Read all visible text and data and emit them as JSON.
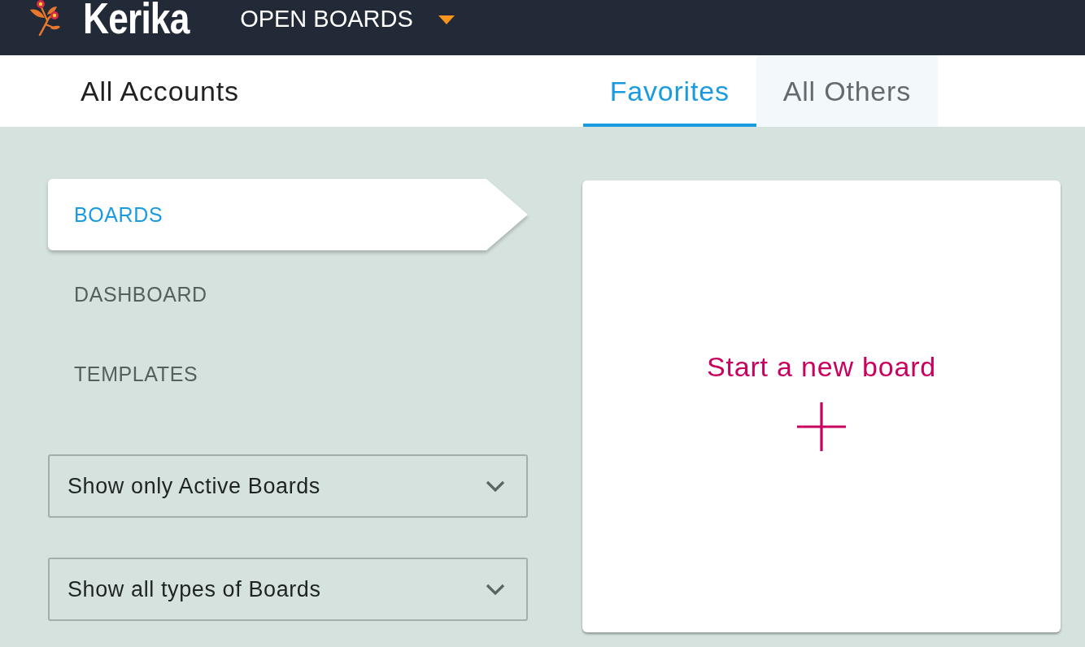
{
  "header": {
    "logo_text": "Kerika",
    "menu": {
      "label": "OPEN BOARDS"
    }
  },
  "account_bar": {
    "title": "All Accounts",
    "tabs": [
      {
        "label": "Favorites",
        "selected": true
      },
      {
        "label": "All Others",
        "selected": false
      }
    ]
  },
  "sidebar": {
    "items": [
      {
        "label": "BOARDS",
        "selected": true
      },
      {
        "label": "DASHBOARD",
        "selected": false
      },
      {
        "label": "TEMPLATES",
        "selected": false
      }
    ],
    "filters": [
      {
        "value": "Show only Active Boards"
      },
      {
        "value": "Show all types of Boards"
      }
    ]
  },
  "new_board_card": {
    "label": "Start a new board"
  }
}
